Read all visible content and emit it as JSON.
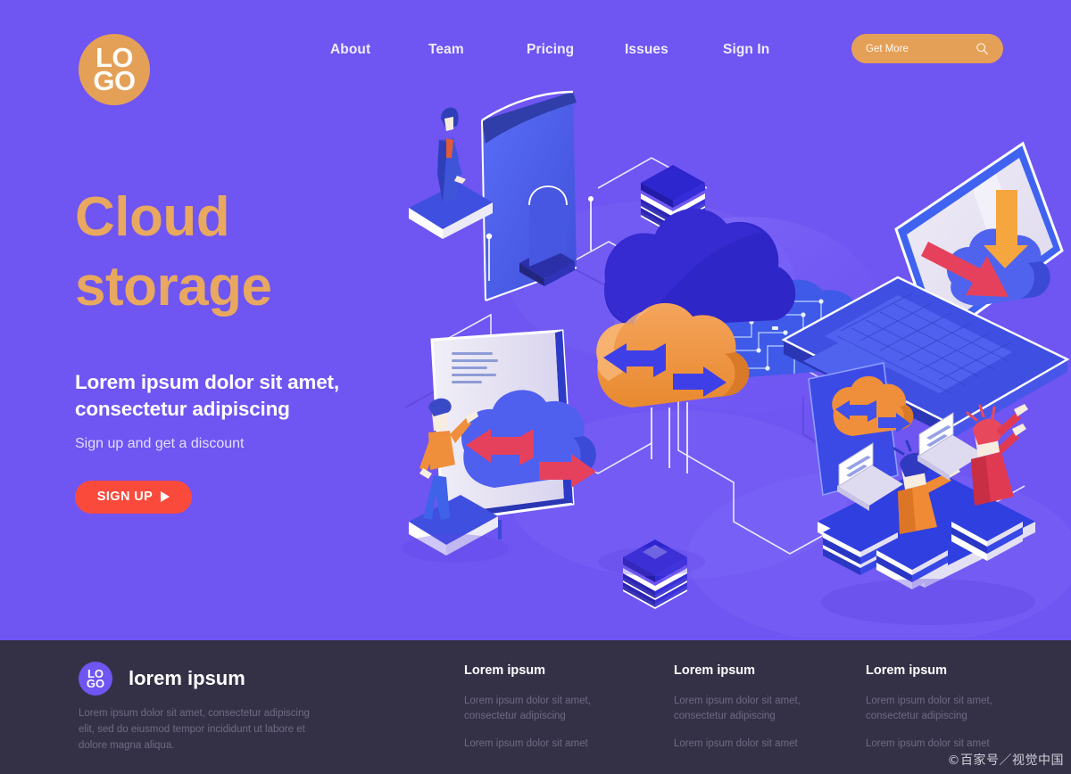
{
  "page": {
    "background_color": "#6f55f2",
    "accent_orange": "#e5a057",
    "accent_red": "#fa4a3c",
    "footer_background": "#343147"
  },
  "header": {
    "logo": {
      "line1": "LO",
      "line2": "GO",
      "icon": "logo-circle-icon",
      "color": "#e5a057"
    },
    "nav_items": [
      {
        "label": "About"
      },
      {
        "label": "Team"
      },
      {
        "label": "Pricing"
      },
      {
        "label": "Issues"
      },
      {
        "label": "Sign In"
      }
    ],
    "cta": {
      "label": "Get More",
      "icon": "search-icon",
      "color": "#e5a057"
    }
  },
  "hero": {
    "title_line1": "Cloud",
    "title_line2": "storage",
    "title_color": "#e8a85f",
    "subtitle_line1": "Lorem ipsum dolor sit amet,",
    "subtitle_line2": "consectetur adipiscing",
    "note": "Sign up and get a discount",
    "button": {
      "label": "SIGN UP",
      "icon": "play-triangle-icon",
      "color": "#fa4a3c"
    }
  },
  "illustration": {
    "name": "isometric-cloud-storage-scene",
    "elements": [
      {
        "name": "curved-display-screen",
        "color": "#4d63f0"
      },
      {
        "name": "standing-businessman-figure",
        "color": "#3b4fc9"
      },
      {
        "name": "server-stack-icon-top",
        "color": "#2d26cf"
      },
      {
        "name": "main-dark-cloud",
        "color": "#2f26c7"
      },
      {
        "name": "orange-sync-cloud",
        "color": "#ef8f3c"
      },
      {
        "name": "circuit-board-cloud",
        "color": "#4a6ef5"
      },
      {
        "name": "laptop-with-cloud-download",
        "color": "#4a5ff0"
      },
      {
        "name": "monitor-with-sync-cloud",
        "color": "#eceaf6"
      },
      {
        "name": "person-orange-jacket-figure",
        "color": "#f08a34"
      },
      {
        "name": "tablet-with-orange-cloud",
        "color": "#4a5ff0"
      },
      {
        "name": "workstation-platform-two-people",
        "color": "#2f3fe0"
      },
      {
        "name": "server-stack-icon-bottom",
        "color": "#2d26cf"
      },
      {
        "name": "network-connector-lines",
        "color": "#ffffff"
      }
    ]
  },
  "footer": {
    "logo": {
      "line1": "LO",
      "line2": "GO",
      "icon": "logo-circle-icon",
      "color": "#6f55f2"
    },
    "brand": "lorem ipsum",
    "description": "Lorem ipsum dolor sit amet, consectetur adipiscing elit, sed do eiusmod tempor incididunt ut labore et dolore magna aliqua.",
    "columns": [
      {
        "heading": "Lorem ipsum",
        "link1": "Lorem ipsum dolor sit amet, consectetur adipiscing",
        "link2": "Lorem ipsum dolor sit amet"
      },
      {
        "heading": "Lorem ipsum",
        "link1": "Lorem ipsum dolor sit amet, consectetur adipiscing",
        "link2": "Lorem ipsum dolor sit amet"
      },
      {
        "heading": "Lorem ipsum",
        "link1": "Lorem ipsum dolor sit amet, consectetur adipiscing",
        "link2": "Lorem ipsum dolor sit amet"
      }
    ]
  },
  "watermark": "©百家号／视觉中国"
}
